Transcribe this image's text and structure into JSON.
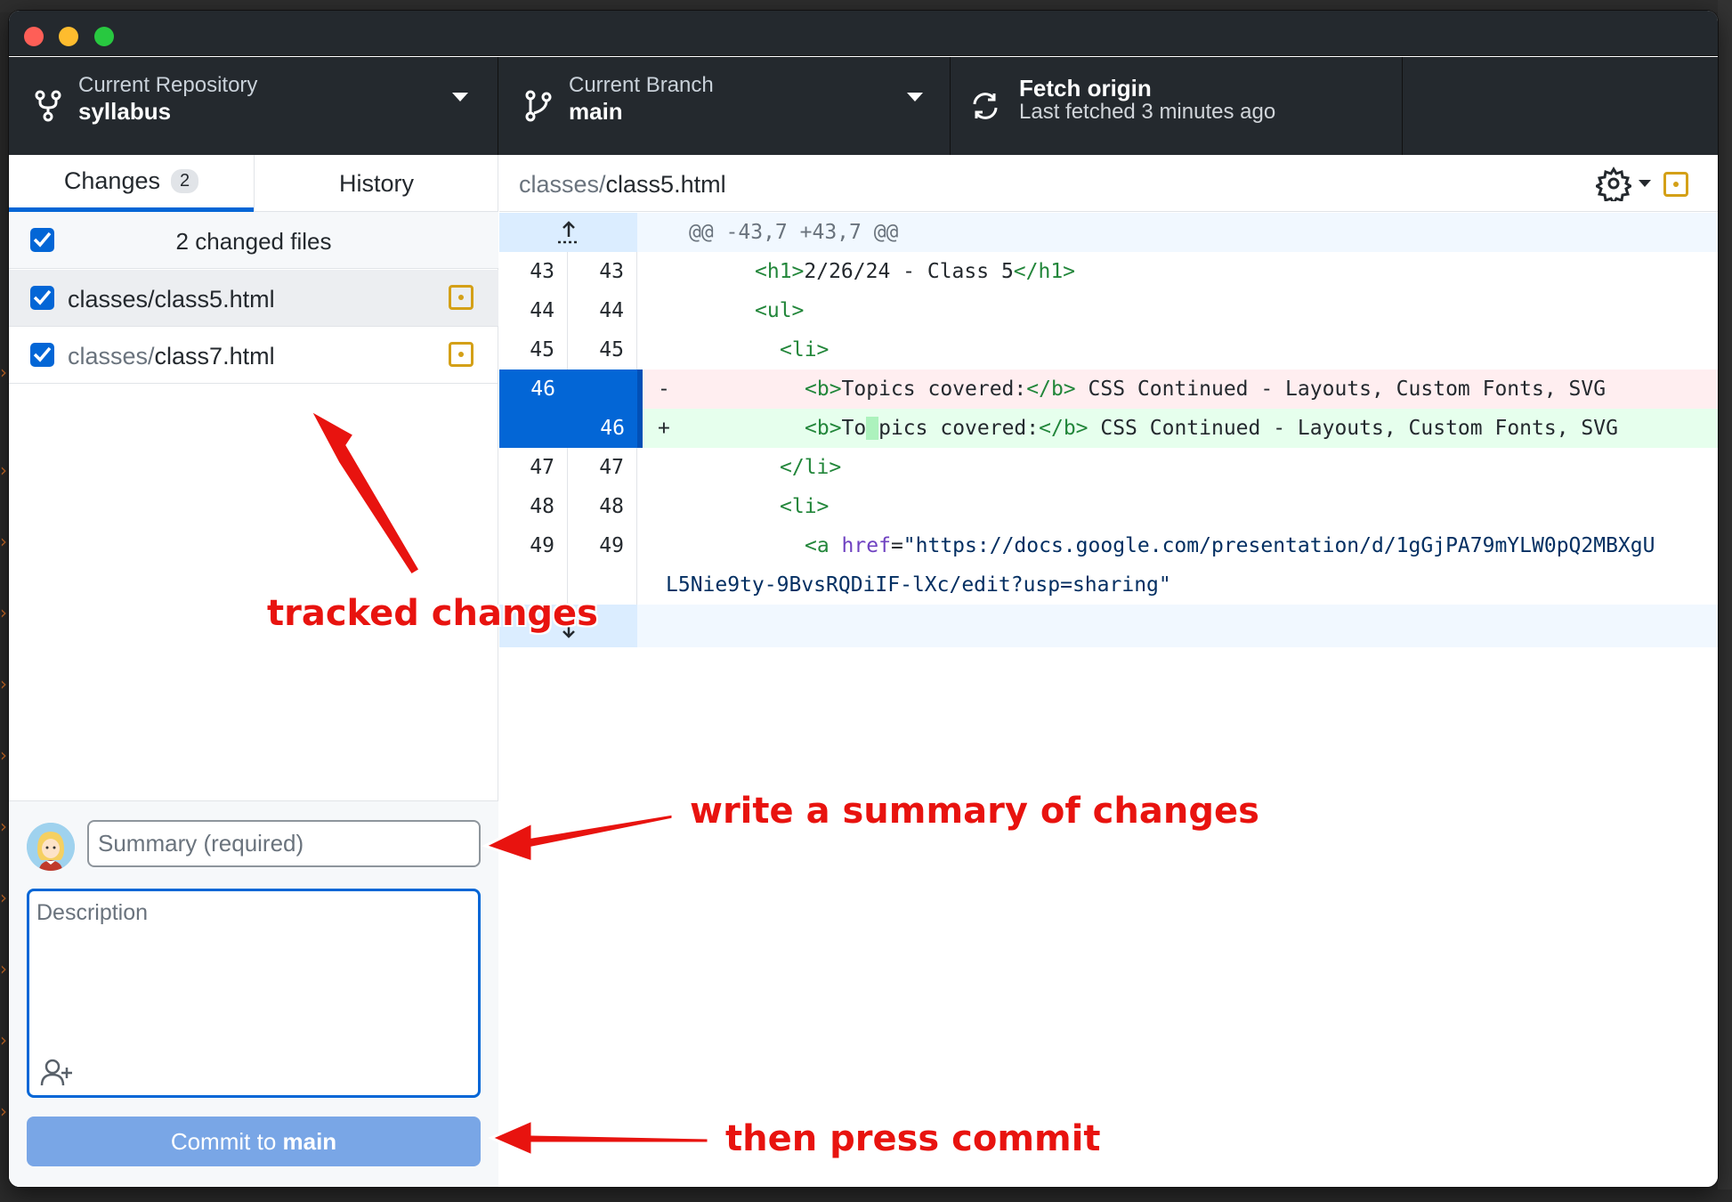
{
  "toolbar": {
    "repo_label": "Current Repository",
    "repo_value": "syllabus",
    "branch_label": "Current Branch",
    "branch_value": "main",
    "fetch_label": "Fetch origin",
    "fetch_sub": "Last fetched 3 minutes ago"
  },
  "tabs": {
    "changes_label": "Changes",
    "changes_count": "2",
    "history_label": "History"
  },
  "changes": {
    "header": "2 changed files",
    "files": [
      {
        "dir": "classes/",
        "name": "class5.html"
      },
      {
        "dir": "classes/",
        "name": "class7.html"
      }
    ]
  },
  "commit": {
    "summary_placeholder": "Summary (required)",
    "description_placeholder": "Description",
    "button_prefix": "Commit to ",
    "button_branch": "main"
  },
  "diff": {
    "path_dir": "classes/",
    "path_file": "class5.html",
    "hunk_header": "@@ -43,7 +43,7 @@",
    "lines": [
      {
        "old": "43",
        "new": "43"
      },
      {
        "old": "44",
        "new": "44"
      },
      {
        "old": "45",
        "new": "45"
      },
      {
        "old": "46",
        "new": "",
        "sign": "-"
      },
      {
        "old": "",
        "new": "46",
        "sign": "+"
      },
      {
        "old": "47",
        "new": "47"
      },
      {
        "old": "48",
        "new": "48"
      },
      {
        "old": "49",
        "new": "49"
      }
    ],
    "code": {
      "l43_open": "<h1>",
      "l43_text": "2/26/24 - Class 5",
      "l43_close": "</h1>",
      "l44": "<ul>",
      "l45": "<li>",
      "l46_del_open": "<b>",
      "l46_del_text": "Topics covered:",
      "l46_del_close": "</b>",
      "l46_del_rest": " CSS Continued - Layouts, Custom Fonts, SVG",
      "l46_add_open": "<b>",
      "l46_add_a": "To",
      "l46_add_hl": " ",
      "l46_add_b": "pics covered:",
      "l46_add_close": "</b>",
      "l46_add_rest": " CSS Continued - Layouts, Custom Fonts, SVG",
      "l47": "</li>",
      "l48": "<li>",
      "l49_open": "<a ",
      "l49_attr": "href",
      "l49_eq": "=",
      "l49_str": "\"https://docs.google.com/presentation/d/1gGjPA79mYLW0pQ2MBXgU",
      "l49_cont": "L5Nie9ty-9BvsRQDiIF-lXc/edit?usp=sharing\""
    }
  },
  "colors": {
    "accent": "#0366d6",
    "toolbar_bg": "#24292e",
    "annotation": "#e8130f",
    "modified_icon": "#d4a017",
    "commit_button": "#79a6e6"
  },
  "annotations": {
    "tracked": "tracked changes",
    "summary": "write a summary of changes",
    "commit": "then press commit"
  }
}
